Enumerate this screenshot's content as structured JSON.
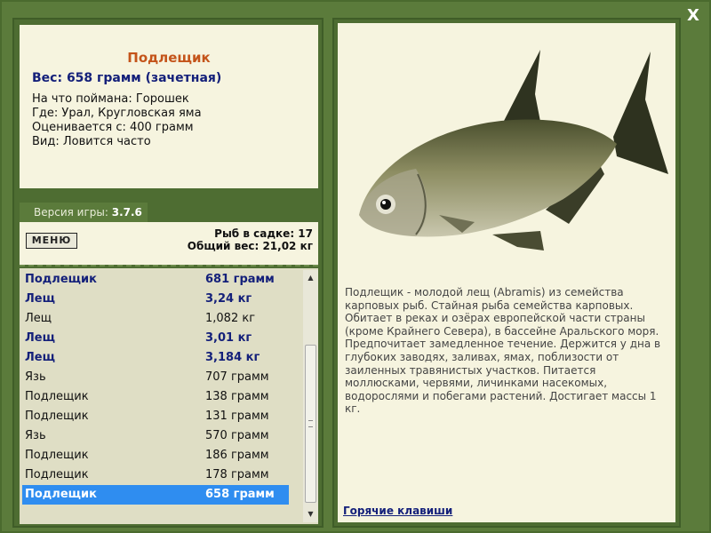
{
  "close": {
    "label": "X"
  },
  "fish": {
    "title": "Подлещик",
    "weight": "Вес: 658 грамм (зачетная)",
    "caught_on": "На что поймана: Горошек",
    "where": "Где: Урал, Кругловская яма",
    "rated_from": "Оценивается с: 400 грамм",
    "kind": "Вид: Ловится часто"
  },
  "version": {
    "label": "Версия игры:",
    "value": "3.7.6"
  },
  "menu": {
    "label": "МЕНЮ"
  },
  "stats": {
    "count": "Рыб в садке: 17",
    "total_weight": "Общий вес: 21,02 кг"
  },
  "catch_list": [
    {
      "name": "Подлещик",
      "weight": "681 грамм",
      "bold": true,
      "selected": false
    },
    {
      "name": "Лещ",
      "weight": "3,24 кг",
      "bold": true,
      "selected": false
    },
    {
      "name": "Лещ",
      "weight": "1,082 кг",
      "bold": false,
      "selected": false
    },
    {
      "name": "Лещ",
      "weight": "3,01 кг",
      "bold": true,
      "selected": false
    },
    {
      "name": "Лещ",
      "weight": "3,184 кг",
      "bold": true,
      "selected": false
    },
    {
      "name": "Язь",
      "weight": "707 грамм",
      "bold": false,
      "selected": false
    },
    {
      "name": "Подлещик",
      "weight": "138 грамм",
      "bold": false,
      "selected": false
    },
    {
      "name": "Подлещик",
      "weight": "131 грамм",
      "bold": false,
      "selected": false
    },
    {
      "name": "Язь",
      "weight": "570 грамм",
      "bold": false,
      "selected": false
    },
    {
      "name": "Подлещик",
      "weight": "186 грамм",
      "bold": false,
      "selected": false
    },
    {
      "name": "Подлещик",
      "weight": "178 грамм",
      "bold": false,
      "selected": false
    },
    {
      "name": "Подлещик",
      "weight": "658 грамм",
      "bold": true,
      "selected": true
    }
  ],
  "description": "Подлещик - молодой лещ (Abramis) из семейства карповых рыб. Стайная рыба семейства карповых. Обитает в реках и озёрах европейской части страны (кроме Крайнего Севера), в бассейне Аральского моря. Предпочитает замедленное течение. Держится у дна в глубоких заводях, заливах, ямах, поблизости от заиленных травянистых участков. Питается моллюсками, червями, личинками насекомых, водорослями и побегами растений. Достигает массы 1 кг.",
  "hotkeys": {
    "label": "Горячие клавиши"
  },
  "colors": {
    "frame": "#5b7b3b",
    "panel_bg": "#f6f4df",
    "title_orange": "#c4541a",
    "navy": "#14207a",
    "selection": "#2f8df0"
  }
}
